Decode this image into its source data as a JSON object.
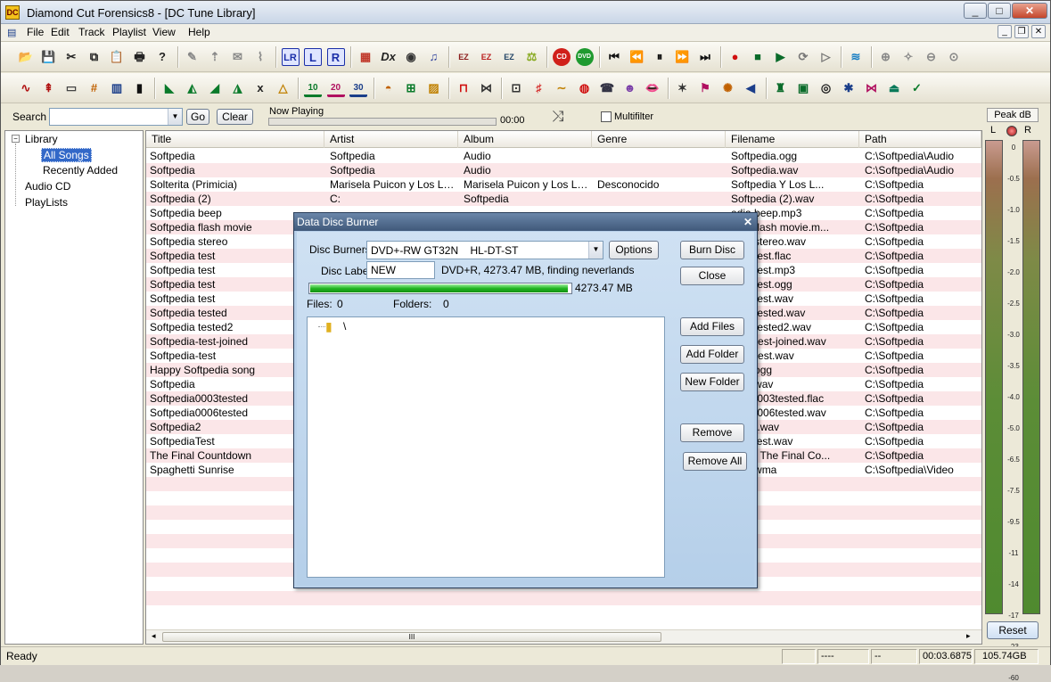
{
  "window": {
    "title": "Diamond Cut Forensics8 - [DC Tune Library]",
    "app_icon_text": "DC",
    "minimize": "_",
    "maximize": "□",
    "close": "✕",
    "mdi_min": "_",
    "mdi_restore": "❐",
    "mdi_close": "✕"
  },
  "menu": [
    "File",
    "Edit",
    "Track",
    "Playlist",
    "View",
    "Help"
  ],
  "toolbar1": [
    {
      "icon": "open-folder-icon",
      "glyph": "📂",
      "color": "#c88a00"
    },
    {
      "icon": "save-icon",
      "glyph": "💾",
      "color": "#334"
    },
    {
      "icon": "cut-icon",
      "glyph": "✂",
      "color": "#222"
    },
    {
      "icon": "copy-icon",
      "glyph": "⧉",
      "color": "#222"
    },
    {
      "icon": "paste-icon",
      "glyph": "📋",
      "color": "#222"
    },
    {
      "icon": "print-icon",
      "glyph": "🖶",
      "color": "#222"
    },
    {
      "icon": "help-icon",
      "glyph": "?",
      "color": "#222"
    },
    {
      "icon": "pencil-icon",
      "glyph": "✎",
      "color": "#888"
    },
    {
      "icon": "marker-up-icon",
      "glyph": "⇡",
      "color": "#888"
    },
    {
      "icon": "envelope-icon",
      "glyph": "✉",
      "color": "#888"
    },
    {
      "icon": "brush-icon",
      "glyph": "⌇",
      "color": "#888"
    },
    {
      "icon": "lr-channel-icon",
      "glyph": "LR",
      "color": "#1b2fa8"
    },
    {
      "icon": "left-channel-icon",
      "glyph": "L",
      "color": "#1b2fa8"
    },
    {
      "icon": "right-channel-icon",
      "glyph": "R",
      "color": "#1b2fa8"
    },
    {
      "icon": "spectrum-icon",
      "glyph": "▦",
      "color": "#c0392b"
    },
    {
      "icon": "dx-plugin-icon",
      "glyph": "Dx",
      "color": "#222"
    },
    {
      "icon": "vst-plugin-icon",
      "glyph": "◉",
      "color": "#333"
    },
    {
      "icon": "score-icon",
      "glyph": "♫",
      "color": "#2b3e9c"
    },
    {
      "icon": "ez-clean-icon",
      "glyph": "EZ",
      "color": "#8a1a1a"
    },
    {
      "icon": "ez-filter-icon",
      "glyph": "EZ",
      "color": "#b22"
    },
    {
      "icon": "ez-tool-icon",
      "glyph": "EZ",
      "color": "#246"
    },
    {
      "icon": "balance-icon",
      "glyph": "⚖",
      "color": "#8a2"
    },
    {
      "icon": "cd-burn-icon",
      "glyph": "CD",
      "color": "#fff"
    },
    {
      "icon": "dvd-burn-icon",
      "glyph": "DVD",
      "color": "#fff"
    },
    {
      "icon": "skip-back-icon",
      "glyph": "⏮",
      "color": "#111"
    },
    {
      "icon": "rewind-icon",
      "glyph": "⏪",
      "color": "#111"
    },
    {
      "icon": "pause-icon",
      "glyph": "⏸",
      "color": "#111"
    },
    {
      "icon": "fast-forward-icon",
      "glyph": "⏩",
      "color": "#111"
    },
    {
      "icon": "skip-forward-icon",
      "glyph": "⏭",
      "color": "#111"
    },
    {
      "icon": "record-icon",
      "glyph": "●",
      "color": "#d01010"
    },
    {
      "icon": "stop-icon",
      "glyph": "■",
      "color": "#0a6b2a"
    },
    {
      "icon": "play-icon",
      "glyph": "▶",
      "color": "#0a6b2a"
    },
    {
      "icon": "loop-icon",
      "glyph": "⟳",
      "color": "#777"
    },
    {
      "icon": "play-selection-icon",
      "glyph": "▷",
      "color": "#777"
    },
    {
      "icon": "batch-icon",
      "glyph": "≋",
      "color": "#1a7fc4"
    },
    {
      "icon": "zoom-in-icon",
      "glyph": "⊕",
      "color": "#888"
    },
    {
      "icon": "zoom-tool-icon",
      "glyph": "✧",
      "color": "#888"
    },
    {
      "icon": "zoom-out-icon",
      "glyph": "⊖",
      "color": "#888"
    },
    {
      "icon": "zoom-fit-icon",
      "glyph": "⊙",
      "color": "#888"
    }
  ],
  "toolbar2": [
    {
      "icon": "waveform-icon",
      "glyph": "∿",
      "color": "#b01010"
    },
    {
      "icon": "marker-icon",
      "glyph": "⇞",
      "color": "#b01010"
    },
    {
      "icon": "spectrogram-icon",
      "glyph": "▭",
      "color": "#444"
    },
    {
      "icon": "grid-eq-icon",
      "glyph": "#",
      "color": "#c06000"
    },
    {
      "icon": "bars-icon",
      "glyph": "▥",
      "color": "#1b3e8a"
    },
    {
      "icon": "level-icon",
      "glyph": "▮",
      "color": "#111"
    },
    {
      "icon": "lowpass-icon",
      "glyph": "◣",
      "color": "#0a7a2a"
    },
    {
      "icon": "bandpass-icon",
      "glyph": "◭",
      "color": "#0a7a2a"
    },
    {
      "icon": "highpass-icon",
      "glyph": "◢",
      "color": "#0a7a2a"
    },
    {
      "icon": "notch-icon",
      "glyph": "◮",
      "color": "#0a7a2a"
    },
    {
      "icon": "multiply-icon",
      "glyph": "x",
      "color": "#222"
    },
    {
      "icon": "triangle-filter-icon",
      "glyph": "△",
      "color": "#c08000"
    },
    {
      "icon": "eq10-icon",
      "glyph": "10",
      "color": "#0a7a2a"
    },
    {
      "icon": "eq20-icon",
      "glyph": "20",
      "color": "#b01060"
    },
    {
      "icon": "eq30-icon",
      "glyph": "30",
      "color": "#1b3e8a"
    },
    {
      "icon": "dynamics-icon",
      "glyph": "◓",
      "color": "#c06000"
    },
    {
      "icon": "routing-icon",
      "glyph": "⊞",
      "color": "#0a7a2a"
    },
    {
      "icon": "image-icon",
      "glyph": "▨",
      "color": "#c08000"
    },
    {
      "icon": "pulse-icon",
      "glyph": "⊓",
      "color": "#d01010"
    },
    {
      "icon": "declick-icon",
      "glyph": "⋈",
      "color": "#333"
    },
    {
      "icon": "sweep-icon",
      "glyph": "⊡",
      "color": "#333"
    },
    {
      "icon": "pitch-icon",
      "glyph": "♯",
      "color": "#d01010"
    },
    {
      "icon": "sine-icon",
      "glyph": "∼",
      "color": "#c08000"
    },
    {
      "icon": "noise-icon",
      "glyph": "◍",
      "color": "#d01010"
    },
    {
      "icon": "phone-icon",
      "glyph": "☎",
      "color": "#334"
    },
    {
      "icon": "voice-icon",
      "glyph": "☻",
      "color": "#7a3ea8"
    },
    {
      "icon": "lips-icon",
      "glyph": "👄",
      "color": "#d01010"
    },
    {
      "icon": "sparkle-icon",
      "glyph": "✶",
      "color": "#333"
    },
    {
      "icon": "flag-icon",
      "glyph": "⚑",
      "color": "#b01060"
    },
    {
      "icon": "brain-icon",
      "glyph": "✺",
      "color": "#c06000"
    },
    {
      "icon": "speaker-icon",
      "glyph": "◀",
      "color": "#1b3e8a"
    },
    {
      "icon": "mixer-icon",
      "glyph": "♜",
      "color": "#0a6b2a"
    },
    {
      "icon": "monitor-icon",
      "glyph": "▣",
      "color": "#0a6b2a"
    },
    {
      "icon": "dial-icon",
      "glyph": "◎",
      "color": "#222"
    },
    {
      "icon": "star-icon",
      "glyph": "✱",
      "color": "#1b3e8a"
    },
    {
      "icon": "bowtie-icon",
      "glyph": "⋈",
      "color": "#b01060"
    },
    {
      "icon": "lamp-icon",
      "glyph": "⏏",
      "color": "#0a7a5a"
    },
    {
      "icon": "check-wave-icon",
      "glyph": "✓",
      "color": "#0a7a2a"
    }
  ],
  "search": {
    "label": "Search",
    "value": "",
    "go": "Go",
    "clear": "Clear",
    "now_playing_label": "Now Playing",
    "time": "00:00",
    "multifilter": "Multifilter",
    "multifilter_checked": false
  },
  "tree": {
    "library": "Library",
    "all_songs": "All Songs",
    "recently_added": "Recently Added",
    "audio_cd": "Audio CD",
    "playlists": "PlayLists"
  },
  "list": {
    "columns": [
      "Title",
      "Artist",
      "Album",
      "Genre",
      "Filename",
      "Path"
    ],
    "rows": [
      [
        "Softpedia",
        "Softpedia",
        "Audio",
        "",
        "Softpedia.ogg",
        "C:\\Softpedia\\Audio"
      ],
      [
        "Softpedia",
        "Softpedia",
        "Audio",
        "",
        "Softpedia.wav",
        "C:\\Softpedia\\Audio"
      ],
      [
        "Solterita (Primicia)",
        "Marisela Puicon y Los La...",
        "Marisela Puicon y Los La...",
        "Desconocido",
        "Softpedia Y Los L...",
        "C:\\Softpedia"
      ],
      [
        "Softpedia (2)",
        "C:",
        "Softpedia",
        "",
        "Softpedia (2).wav",
        "C:\\Softpedia"
      ],
      [
        "Softpedia beep",
        "",
        "",
        "",
        "edia beep.mp3",
        "C:\\Softpedia"
      ],
      [
        "Softpedia flash movie",
        "",
        "",
        "",
        "edia flash movie.m...",
        "C:\\Softpedia"
      ],
      [
        "Softpedia stereo",
        "",
        "",
        "",
        "edia stereo.wav",
        "C:\\Softpedia"
      ],
      [
        "Softpedia test",
        "",
        "",
        "",
        "edia test.flac",
        "C:\\Softpedia"
      ],
      [
        "Softpedia test",
        "",
        "",
        "",
        "edia test.mp3",
        "C:\\Softpedia"
      ],
      [
        "Softpedia test",
        "",
        "",
        "",
        "edia test.ogg",
        "C:\\Softpedia"
      ],
      [
        "Softpedia test",
        "",
        "",
        "",
        "edia test.wav",
        "C:\\Softpedia"
      ],
      [
        "Softpedia tested",
        "",
        "",
        "",
        "edia tested.wav",
        "C:\\Softpedia"
      ],
      [
        "Softpedia tested2",
        "",
        "",
        "",
        "edia tested2.wav",
        "C:\\Softpedia"
      ],
      [
        "Softpedia-test-joined",
        "",
        "",
        "",
        "edia-test-joined.wav",
        "C:\\Softpedia"
      ],
      [
        "Softpedia-test",
        "",
        "",
        "",
        "edia-test.wav",
        "C:\\Softpedia"
      ],
      [
        "Happy Softpedia song",
        "",
        "",
        "",
        "edia.ogg",
        "C:\\Softpedia"
      ],
      [
        "Softpedia",
        "",
        "",
        "",
        "edia.wav",
        "C:\\Softpedia"
      ],
      [
        "Softpedia0003tested",
        "",
        "",
        "",
        "edia0003tested.flac",
        "C:\\Softpedia"
      ],
      [
        "Softpedia0006tested",
        "",
        "",
        "",
        "edia0006tested.wav",
        "C:\\Softpedia"
      ],
      [
        "Softpedia2",
        "",
        "",
        "",
        "edia2.wav",
        "C:\\Softpedia"
      ],
      [
        "SoftpediaTest",
        "",
        "",
        "",
        "ediaTest.wav",
        "C:\\Softpedia"
      ],
      [
        "The Final Countdown",
        "",
        "",
        "",
        "esia - The Final Co...",
        "C:\\Softpedia"
      ],
      [
        "Spaghetti Sunrise",
        "",
        "",
        "",
        "edia.wma",
        "C:\\Softpedia\\Video"
      ],
      [
        "",
        "",
        "",
        "",
        "",
        ""
      ],
      [
        "",
        "",
        "",
        "",
        "",
        ""
      ],
      [
        "",
        "",
        "",
        "",
        "",
        ""
      ],
      [
        "",
        "",
        "",
        "",
        "",
        ""
      ],
      [
        "",
        "",
        "",
        "",
        "",
        ""
      ],
      [
        "",
        "",
        "",
        "",
        "",
        ""
      ],
      [
        "",
        "",
        "",
        "",
        "",
        ""
      ],
      [
        "",
        "",
        "",
        "",
        "",
        ""
      ],
      [
        "",
        "",
        "",
        "",
        "",
        ""
      ],
      [
        "",
        "",
        "",
        "",
        "",
        ""
      ]
    ],
    "scroll_grip": "III"
  },
  "peak": {
    "label": "Peak dB",
    "left": "L",
    "right": "R",
    "ticks": [
      "0",
      "-0.5",
      "-1.0",
      "-1.5",
      "-2.0",
      "-2.5",
      "-3.0",
      "-3.5",
      "-4.0",
      "-5.0",
      "-6.5",
      "-7.5",
      "-9.5",
      "-11",
      "-14",
      "-17",
      "-23",
      "-60"
    ],
    "reset": "Reset"
  },
  "status": {
    "ready": "Ready",
    "cell1": "",
    "cell2": "----",
    "cell3": "--",
    "time": "00:03.6875",
    "size": "105.74GB"
  },
  "dialog": {
    "title": "Data Disc Burner",
    "close": "✕",
    "burners_label": "Disc Burners:",
    "burner_value": "DVD+-RW GT32N    HL-DT-ST",
    "label_label": "Disc Label:",
    "label_value": "NEW",
    "disc_info": "DVD+R, 4273.47 MB, finding neverlands",
    "progress_text": "4273.47 MB",
    "progress_fraction": 0.99,
    "files_label": "Files:",
    "files_count": "0",
    "folders_label": "Folders:",
    "folders_count": "0",
    "root_folder": "\\",
    "buttons": {
      "options": "Options",
      "burn": "Burn Disc",
      "close": "Close",
      "add_files": "Add Files",
      "add_folder": "Add Folder",
      "new_folder": "New Folder",
      "remove": "Remove",
      "remove_all": "Remove All"
    }
  }
}
